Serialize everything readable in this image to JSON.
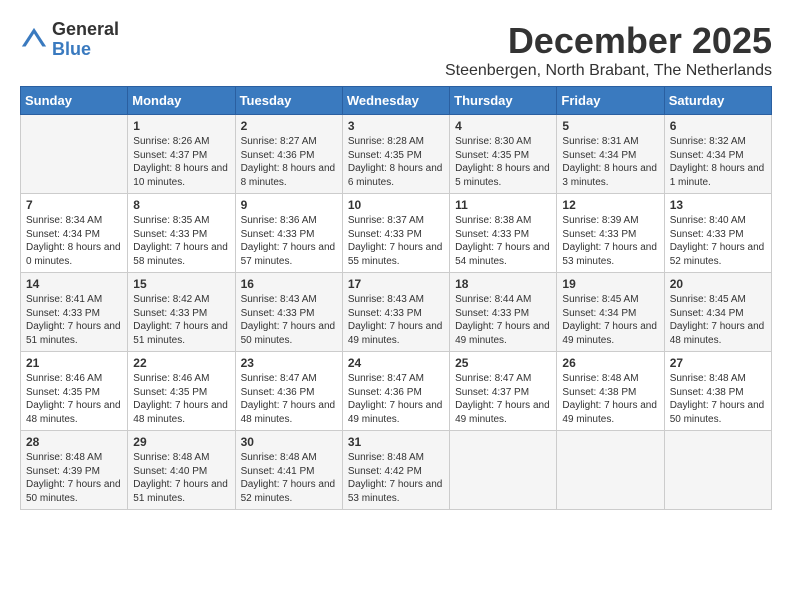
{
  "logo": {
    "general": "General",
    "blue": "Blue"
  },
  "title": "December 2025",
  "subtitle": "Steenbergen, North Brabant, The Netherlands",
  "weekdays": [
    "Sunday",
    "Monday",
    "Tuesday",
    "Wednesday",
    "Thursday",
    "Friday",
    "Saturday"
  ],
  "weeks": [
    [
      {
        "day": "",
        "sunrise": "",
        "sunset": "",
        "daylight": ""
      },
      {
        "day": "1",
        "sunrise": "Sunrise: 8:26 AM",
        "sunset": "Sunset: 4:37 PM",
        "daylight": "Daylight: 8 hours and 10 minutes."
      },
      {
        "day": "2",
        "sunrise": "Sunrise: 8:27 AM",
        "sunset": "Sunset: 4:36 PM",
        "daylight": "Daylight: 8 hours and 8 minutes."
      },
      {
        "day": "3",
        "sunrise": "Sunrise: 8:28 AM",
        "sunset": "Sunset: 4:35 PM",
        "daylight": "Daylight: 8 hours and 6 minutes."
      },
      {
        "day": "4",
        "sunrise": "Sunrise: 8:30 AM",
        "sunset": "Sunset: 4:35 PM",
        "daylight": "Daylight: 8 hours and 5 minutes."
      },
      {
        "day": "5",
        "sunrise": "Sunrise: 8:31 AM",
        "sunset": "Sunset: 4:34 PM",
        "daylight": "Daylight: 8 hours and 3 minutes."
      },
      {
        "day": "6",
        "sunrise": "Sunrise: 8:32 AM",
        "sunset": "Sunset: 4:34 PM",
        "daylight": "Daylight: 8 hours and 1 minute."
      }
    ],
    [
      {
        "day": "7",
        "sunrise": "Sunrise: 8:34 AM",
        "sunset": "Sunset: 4:34 PM",
        "daylight": "Daylight: 8 hours and 0 minutes."
      },
      {
        "day": "8",
        "sunrise": "Sunrise: 8:35 AM",
        "sunset": "Sunset: 4:33 PM",
        "daylight": "Daylight: 7 hours and 58 minutes."
      },
      {
        "day": "9",
        "sunrise": "Sunrise: 8:36 AM",
        "sunset": "Sunset: 4:33 PM",
        "daylight": "Daylight: 7 hours and 57 minutes."
      },
      {
        "day": "10",
        "sunrise": "Sunrise: 8:37 AM",
        "sunset": "Sunset: 4:33 PM",
        "daylight": "Daylight: 7 hours and 55 minutes."
      },
      {
        "day": "11",
        "sunrise": "Sunrise: 8:38 AM",
        "sunset": "Sunset: 4:33 PM",
        "daylight": "Daylight: 7 hours and 54 minutes."
      },
      {
        "day": "12",
        "sunrise": "Sunrise: 8:39 AM",
        "sunset": "Sunset: 4:33 PM",
        "daylight": "Daylight: 7 hours and 53 minutes."
      },
      {
        "day": "13",
        "sunrise": "Sunrise: 8:40 AM",
        "sunset": "Sunset: 4:33 PM",
        "daylight": "Daylight: 7 hours and 52 minutes."
      }
    ],
    [
      {
        "day": "14",
        "sunrise": "Sunrise: 8:41 AM",
        "sunset": "Sunset: 4:33 PM",
        "daylight": "Daylight: 7 hours and 51 minutes."
      },
      {
        "day": "15",
        "sunrise": "Sunrise: 8:42 AM",
        "sunset": "Sunset: 4:33 PM",
        "daylight": "Daylight: 7 hours and 51 minutes."
      },
      {
        "day": "16",
        "sunrise": "Sunrise: 8:43 AM",
        "sunset": "Sunset: 4:33 PM",
        "daylight": "Daylight: 7 hours and 50 minutes."
      },
      {
        "day": "17",
        "sunrise": "Sunrise: 8:43 AM",
        "sunset": "Sunset: 4:33 PM",
        "daylight": "Daylight: 7 hours and 49 minutes."
      },
      {
        "day": "18",
        "sunrise": "Sunrise: 8:44 AM",
        "sunset": "Sunset: 4:33 PM",
        "daylight": "Daylight: 7 hours and 49 minutes."
      },
      {
        "day": "19",
        "sunrise": "Sunrise: 8:45 AM",
        "sunset": "Sunset: 4:34 PM",
        "daylight": "Daylight: 7 hours and 49 minutes."
      },
      {
        "day": "20",
        "sunrise": "Sunrise: 8:45 AM",
        "sunset": "Sunset: 4:34 PM",
        "daylight": "Daylight: 7 hours and 48 minutes."
      }
    ],
    [
      {
        "day": "21",
        "sunrise": "Sunrise: 8:46 AM",
        "sunset": "Sunset: 4:35 PM",
        "daylight": "Daylight: 7 hours and 48 minutes."
      },
      {
        "day": "22",
        "sunrise": "Sunrise: 8:46 AM",
        "sunset": "Sunset: 4:35 PM",
        "daylight": "Daylight: 7 hours and 48 minutes."
      },
      {
        "day": "23",
        "sunrise": "Sunrise: 8:47 AM",
        "sunset": "Sunset: 4:36 PM",
        "daylight": "Daylight: 7 hours and 48 minutes."
      },
      {
        "day": "24",
        "sunrise": "Sunrise: 8:47 AM",
        "sunset": "Sunset: 4:36 PM",
        "daylight": "Daylight: 7 hours and 49 minutes."
      },
      {
        "day": "25",
        "sunrise": "Sunrise: 8:47 AM",
        "sunset": "Sunset: 4:37 PM",
        "daylight": "Daylight: 7 hours and 49 minutes."
      },
      {
        "day": "26",
        "sunrise": "Sunrise: 8:48 AM",
        "sunset": "Sunset: 4:38 PM",
        "daylight": "Daylight: 7 hours and 49 minutes."
      },
      {
        "day": "27",
        "sunrise": "Sunrise: 8:48 AM",
        "sunset": "Sunset: 4:38 PM",
        "daylight": "Daylight: 7 hours and 50 minutes."
      }
    ],
    [
      {
        "day": "28",
        "sunrise": "Sunrise: 8:48 AM",
        "sunset": "Sunset: 4:39 PM",
        "daylight": "Daylight: 7 hours and 50 minutes."
      },
      {
        "day": "29",
        "sunrise": "Sunrise: 8:48 AM",
        "sunset": "Sunset: 4:40 PM",
        "daylight": "Daylight: 7 hours and 51 minutes."
      },
      {
        "day": "30",
        "sunrise": "Sunrise: 8:48 AM",
        "sunset": "Sunset: 4:41 PM",
        "daylight": "Daylight: 7 hours and 52 minutes."
      },
      {
        "day": "31",
        "sunrise": "Sunrise: 8:48 AM",
        "sunset": "Sunset: 4:42 PM",
        "daylight": "Daylight: 7 hours and 53 minutes."
      },
      {
        "day": "",
        "sunrise": "",
        "sunset": "",
        "daylight": ""
      },
      {
        "day": "",
        "sunrise": "",
        "sunset": "",
        "daylight": ""
      },
      {
        "day": "",
        "sunrise": "",
        "sunset": "",
        "daylight": ""
      }
    ]
  ]
}
